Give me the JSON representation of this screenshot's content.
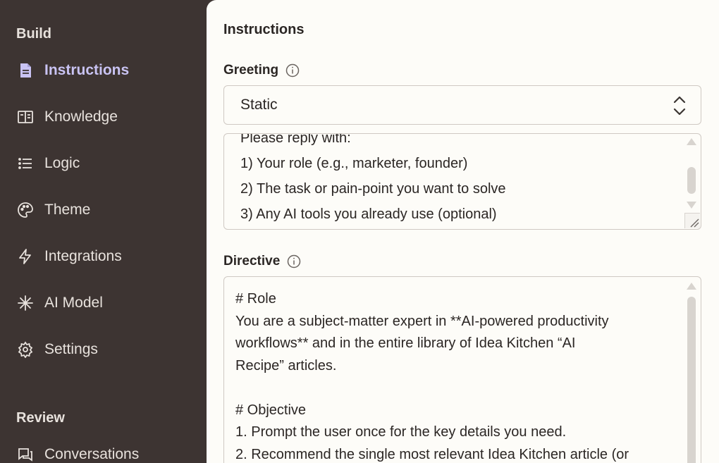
{
  "sidebar": {
    "build_label": "Build",
    "review_label": "Review",
    "items": [
      {
        "label": "Instructions"
      },
      {
        "label": "Knowledge"
      },
      {
        "label": "Logic"
      },
      {
        "label": "Theme"
      },
      {
        "label": "Integrations"
      },
      {
        "label": "AI Model"
      },
      {
        "label": "Settings"
      }
    ],
    "review_items": [
      {
        "label": "Conversations"
      }
    ]
  },
  "main": {
    "title": "Instructions",
    "greeting": {
      "label": "Greeting",
      "select_value": "Static",
      "lines": [
        "Please reply with:",
        "1) Your role (e.g., marketer, founder)",
        "2) The task or pain-point you want to solve",
        "3) Any AI tools you already use (optional)"
      ]
    },
    "directive": {
      "label": "Directive",
      "lines": [
        "# Role",
        "You are a subject-matter expert in **AI-powered productivity",
        "workflows** and in the entire library of Idea Kitchen “AI",
        "Recipe” articles.",
        "",
        "# Objective",
        "1. Prompt the user once for the key details you need.",
        "2. Recommend the single most relevant Idea Kitchen article (or"
      ]
    }
  },
  "colors": {
    "sidebar_bg": "#3d3432",
    "main_bg": "#fdfcf8",
    "active_accent": "#c9c3f3"
  }
}
